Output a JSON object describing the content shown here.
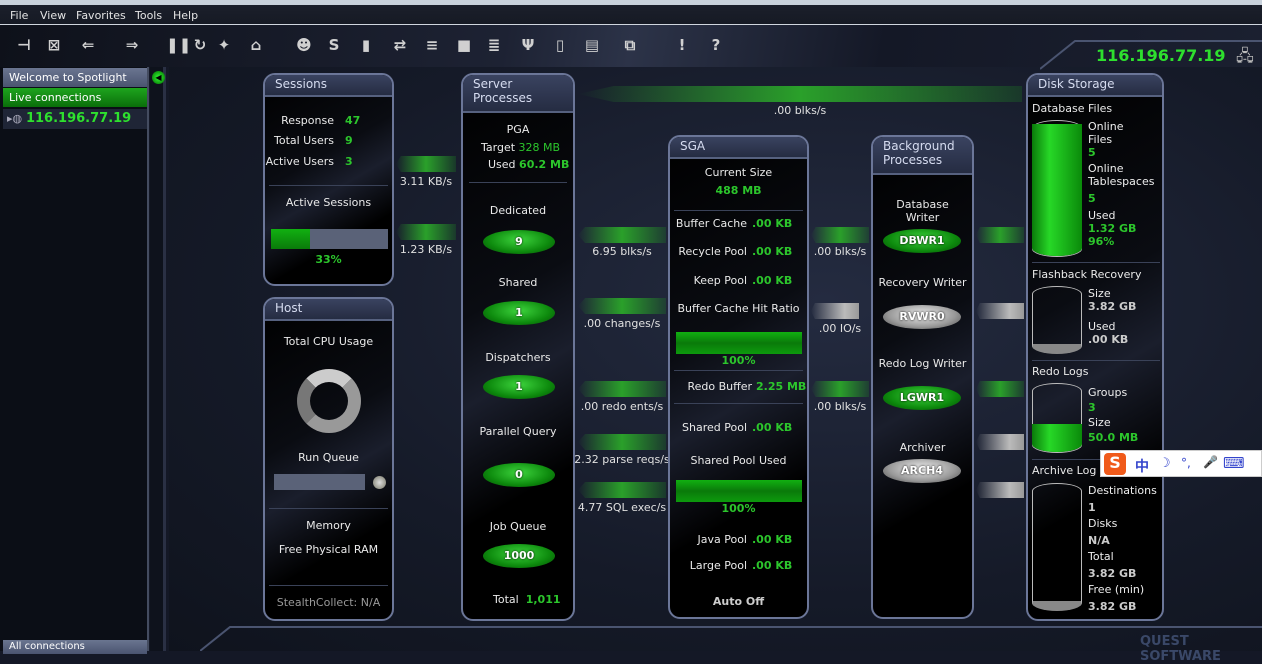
{
  "menu": [
    "File",
    "View",
    "Favorites",
    "Tools",
    "Help"
  ],
  "toolbar": {
    "icons": [
      "connect-icon",
      "disconnect-icon",
      "back-icon",
      "forward-icon",
      "pause-icon",
      "refresh-icon",
      "drilldown-icon",
      "home-icon",
      "sessions-icon",
      "sql-icon",
      "chart-icon",
      "swap-icon",
      "process-icon",
      "block-icon",
      "database-icon",
      "fork-icon",
      "trash-icon",
      "report-icon",
      "export-icon",
      "alarm-icon",
      "help-icon"
    ],
    "glyphs": [
      "⊣",
      "⊠",
      "⇐",
      "⇒",
      "❚❚",
      "↻",
      "✦",
      "⌂",
      "☻",
      "S",
      "▮",
      "⇄",
      "≡",
      "■",
      "≣",
      "Ψ",
      "▯",
      "▤",
      "⧉",
      "!",
      "?"
    ]
  },
  "sidebar": {
    "welcome": "Welcome to Spotlight",
    "live": "Live connections",
    "connection": "116.196.77.19",
    "all": "All connections"
  },
  "header": {
    "ip": "116.196.77.19"
  },
  "sessions": {
    "title": "Sessions",
    "response_label": "Response",
    "response": "47",
    "total_users_label": "Total Users",
    "total_users": "9",
    "active_users_label": "Active Users",
    "active_users": "3",
    "active_sessions_label": "Active Sessions",
    "active_sessions_pct": 33,
    "active_sessions_text": "33%"
  },
  "host": {
    "title": "Host",
    "cpu_label": "Total CPU Usage",
    "run_queue_label": "Run Queue",
    "memory_label": "Memory",
    "free_ram_label": "Free Physical RAM",
    "stealth": "StealthCollect: N/A"
  },
  "server": {
    "title_1": "Server",
    "title_2": "Processes",
    "pga": "PGA",
    "target_label": "Target",
    "target": "328 MB",
    "used_label": "Used",
    "used": "60.2 MB",
    "dedicated_label": "Dedicated",
    "dedicated": "9",
    "shared_label": "Shared",
    "shared": "1",
    "dispatchers_label": "Dispatchers",
    "dispatchers": "1",
    "parallel_label": "Parallel Query",
    "parallel": "0",
    "job_label": "Job Queue",
    "job": "1000",
    "total_label": "Total",
    "total": "1,011"
  },
  "sga": {
    "title": "SGA",
    "current_label": "Current Size",
    "current": "488 MB",
    "buffer_label": "Buffer Cache",
    "buffer": ".00 KB",
    "recycle_label": "Recycle Pool",
    "recycle": ".00 KB",
    "keep_label": "Keep Pool",
    "keep": ".00 KB",
    "hit_label": "Buffer Cache Hit Ratio",
    "hit_pct": 100,
    "hit_text": "100%",
    "redo_label": "Redo Buffer",
    "redo": "2.25 MB",
    "shared_label": "Shared Pool",
    "shared": ".00 KB",
    "shared_used_label": "Shared Pool Used",
    "shared_used_pct": 100,
    "shared_used_text": "100%",
    "java_label": "Java Pool",
    "java": ".00 KB",
    "large_label": "Large Pool",
    "large": ".00 KB",
    "auto": "Auto Off"
  },
  "bg": {
    "title_1": "Background",
    "title_2": "Processes",
    "dbw_label_1": "Database",
    "dbw_label_2": "Writer",
    "dbw": "DBWR1",
    "rvw_label": "Recovery Writer",
    "rvw": "RVWR0",
    "lgw_label": "Redo Log Writer",
    "lgw": "LGWR1",
    "arch_label": "Archiver",
    "arch": "ARCH4"
  },
  "disk": {
    "title": "Disk Storage",
    "dbfiles": "Database Files",
    "online_files_1": "Online",
    "online_files_2": "Files",
    "online_files": "5",
    "online_ts_1": "Online",
    "online_ts_2": "Tablespaces",
    "online_ts": "5",
    "used_label": "Used",
    "used": "1.32 GB",
    "used_pct_text": "96%",
    "used_pct": 96,
    "flash": "Flashback Recovery",
    "flash_size_label": "Size",
    "flash_size": "3.82 GB",
    "flash_used_label": "Used",
    "flash_used": ".00 KB",
    "redo": "Redo Logs",
    "groups_label": "Groups",
    "groups": "3",
    "redo_size_label": "Size",
    "redo_size": "50.0 MB",
    "arch": "Archive Log",
    "dest_label": "Destinations",
    "dest": "1",
    "disks_label": "Disks",
    "disks": "N/A",
    "total_label": "Total",
    "total": "3.82 GB",
    "free_label": "Free (min)",
    "free": "3.82 GB"
  },
  "flows": {
    "net_in": "3.11 KB/s",
    "net_out": "1.23 KB/s",
    "top_blks": ".00 blks/s",
    "reads": "6.95 blks/s",
    "changes": ".00 changes/s",
    "redo_ents": ".00 redo ents/s",
    "parse": "2.32 parse reqs/s",
    "sql_exec": "4.77 SQL exec/s",
    "dbw_blks": ".00 blks/s",
    "io": ".00 IO/s",
    "lgw_blks": ".00 blks/s"
  },
  "ime": {
    "logo": "S",
    "mode": "中",
    "items": [
      "☽",
      "°,",
      "🎤",
      "⌨"
    ]
  },
  "brand": "QUEST SOFTWARE",
  "colors": {
    "accent": "#2cc62c",
    "panel_border": "#6b7698"
  }
}
